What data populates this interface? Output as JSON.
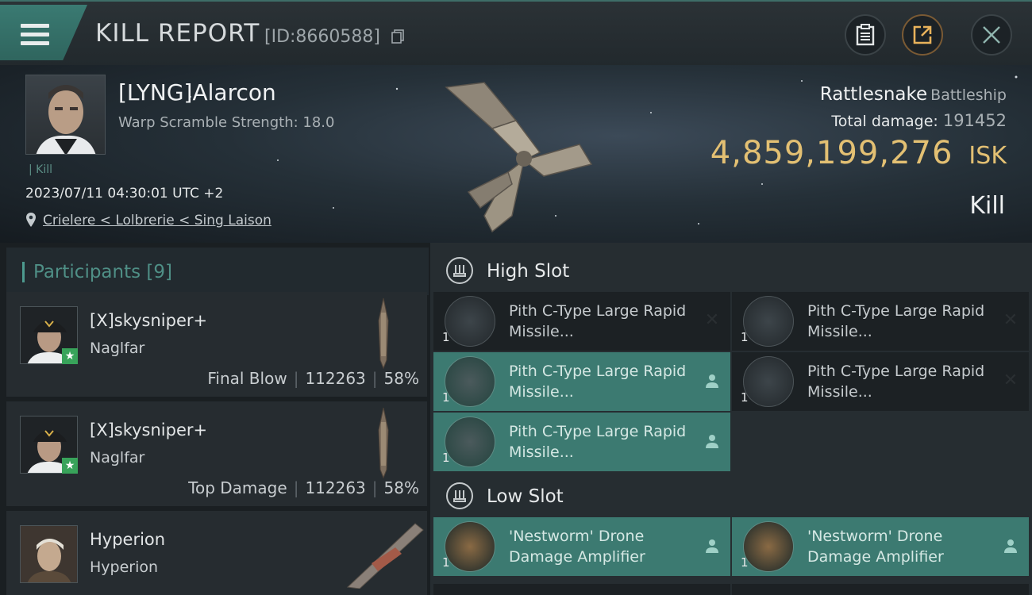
{
  "header": {
    "title": "KILL REPORT",
    "kill_id": "[ID:8660588]"
  },
  "victim": {
    "name": "[LYNG]Alarcon",
    "warp_scramble": "Warp Scramble Strength: 18.0",
    "tag": "Kill",
    "datetime": "2023/07/11 04:30:01 UTC +2",
    "location": "Crielere < Lolbrerie < Sing Laison",
    "ship": "Rattlesnake",
    "ship_class": "Battleship",
    "total_damage_label": "Total damage:",
    "total_damage": "191452",
    "isk_value": "4,859,199,276",
    "isk_currency": "ISK",
    "result": "Kill"
  },
  "participants": {
    "title": "Participants [9]",
    "items": [
      {
        "name": "[X]skysniper+",
        "ship": "Naglfar",
        "role": "Final Blow",
        "damage": "112263",
        "percent": "58%"
      },
      {
        "name": "[X]skysniper+",
        "ship": "Naglfar",
        "role": "Top Damage",
        "damage": "112263",
        "percent": "58%"
      },
      {
        "name": "Hyperion",
        "ship": "Hyperion"
      }
    ]
  },
  "fittings": {
    "high_slot_label": "High Slot",
    "low_slot_label": "Low Slot",
    "high_slot": [
      {
        "name": "Pith C-Type Large Rapid Missile...",
        "qty": "1",
        "state": "destroyed"
      },
      {
        "name": "Pith C-Type Large Rapid Missile...",
        "qty": "1",
        "state": "destroyed"
      },
      {
        "name": "Pith C-Type Large Rapid Missile...",
        "qty": "1",
        "state": "dropped"
      },
      {
        "name": "Pith C-Type Large Rapid Missile...",
        "qty": "1",
        "state": "destroyed"
      },
      {
        "name": "Pith C-Type Large Rapid Missile...",
        "qty": "1",
        "state": "dropped"
      }
    ],
    "low_slot": [
      {
        "name": "'Nestworm' Drone Damage Amplifier",
        "qty": "1",
        "state": "dropped"
      },
      {
        "name": "'Nestworm' Drone Damage Amplifier",
        "qty": "1",
        "state": "dropped"
      }
    ]
  },
  "colors": {
    "accent_teal": "#3c7a71",
    "isk_gold": "#e3c073",
    "final_blow_badge": "#38a35a"
  }
}
